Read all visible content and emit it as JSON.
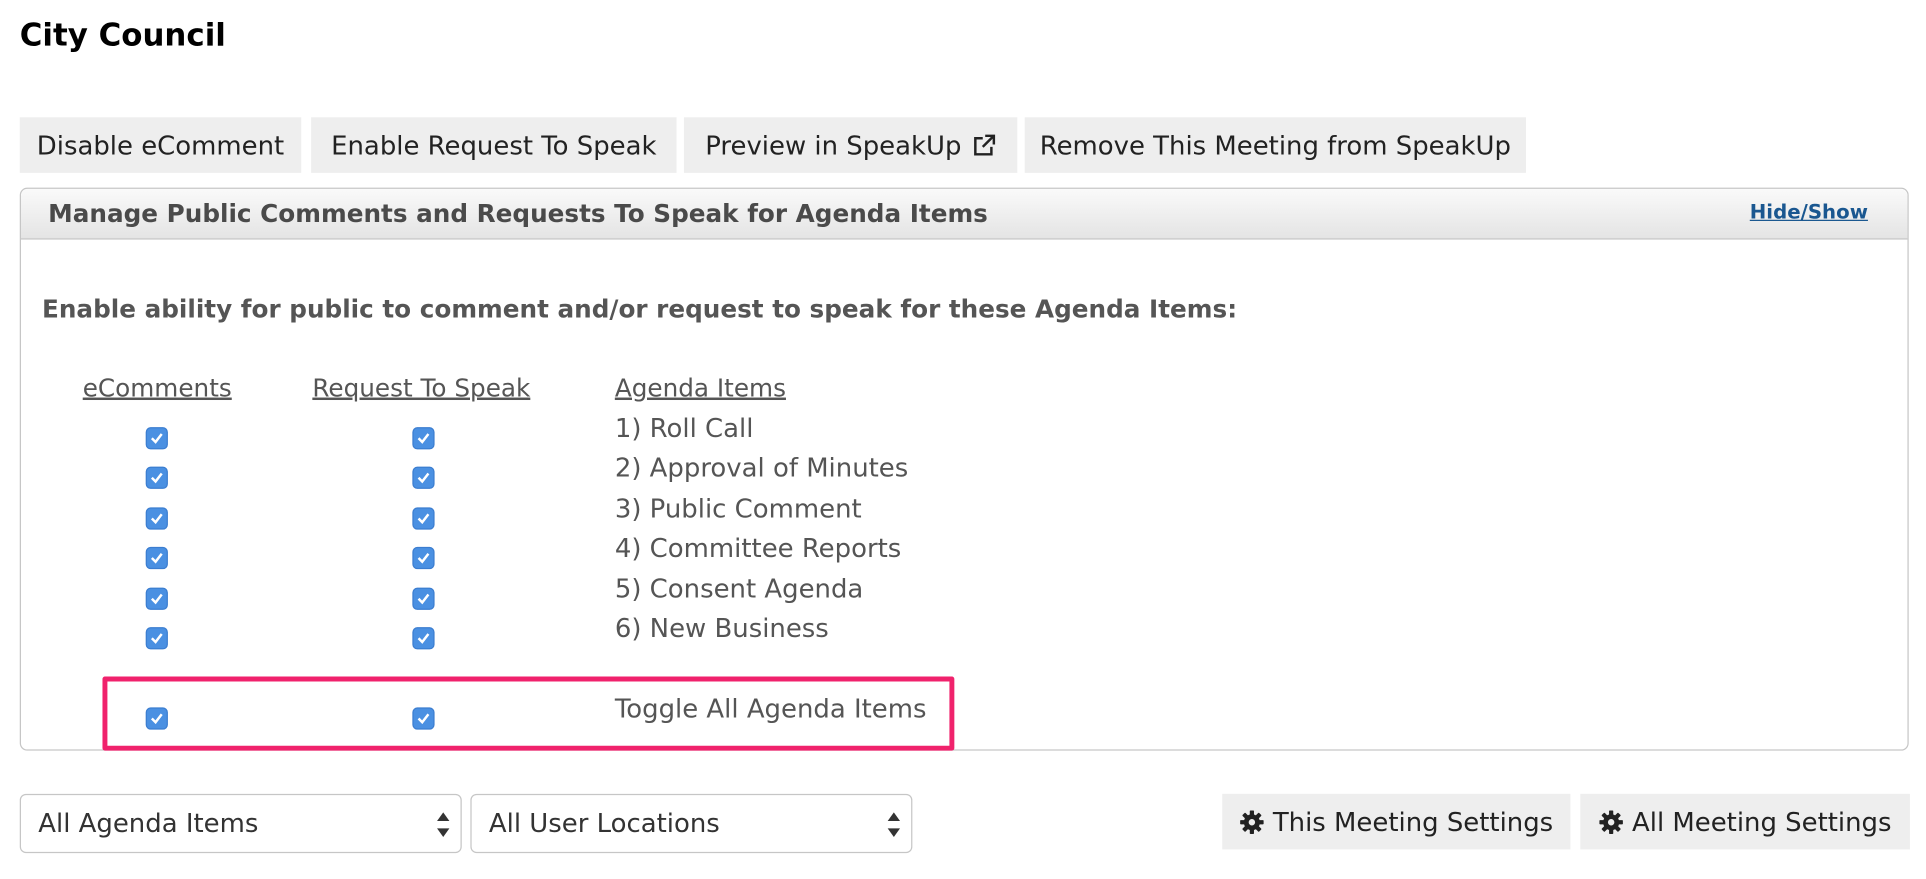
{
  "page": {
    "title": "City Council"
  },
  "toolbar": {
    "disable_ecomment": "Disable eComment",
    "enable_request": "Enable Request To Speak",
    "preview": "Preview in SpeakUp",
    "remove": "Remove This Meeting from SpeakUp"
  },
  "panel": {
    "title": "Manage Public Comments and Requests To Speak for Agenda Items",
    "hide_show": "Hide/Show",
    "instructions": "Enable ability for public to comment and/or request to speak for these Agenda Items:",
    "columns": {
      "ecomments": "eComments",
      "request": "Request To Speak",
      "agenda": "Agenda Items"
    },
    "items": [
      {
        "label": "1) Roll Call",
        "ecomment": true,
        "request": true
      },
      {
        "label": "2) Approval of Minutes",
        "ecomment": true,
        "request": true
      },
      {
        "label": "3) Public Comment",
        "ecomment": true,
        "request": true
      },
      {
        "label": "4) Committee Reports",
        "ecomment": true,
        "request": true
      },
      {
        "label": "5) Consent Agenda",
        "ecomment": true,
        "request": true
      },
      {
        "label": "6) New Business",
        "ecomment": true,
        "request": true
      }
    ],
    "toggle_all": {
      "label": "Toggle All Agenda Items",
      "ecomment": true,
      "request": true
    }
  },
  "filters": {
    "agenda_select": "All Agenda Items",
    "location_select": "All User Locations"
  },
  "settings": {
    "this_meeting": "This Meeting Settings",
    "all_meetings": "All Meeting Settings"
  },
  "colors": {
    "checkbox": "#4a90e2",
    "highlight": "#f0226c",
    "link": "#1a5790",
    "button_bg": "#eeeeee"
  }
}
